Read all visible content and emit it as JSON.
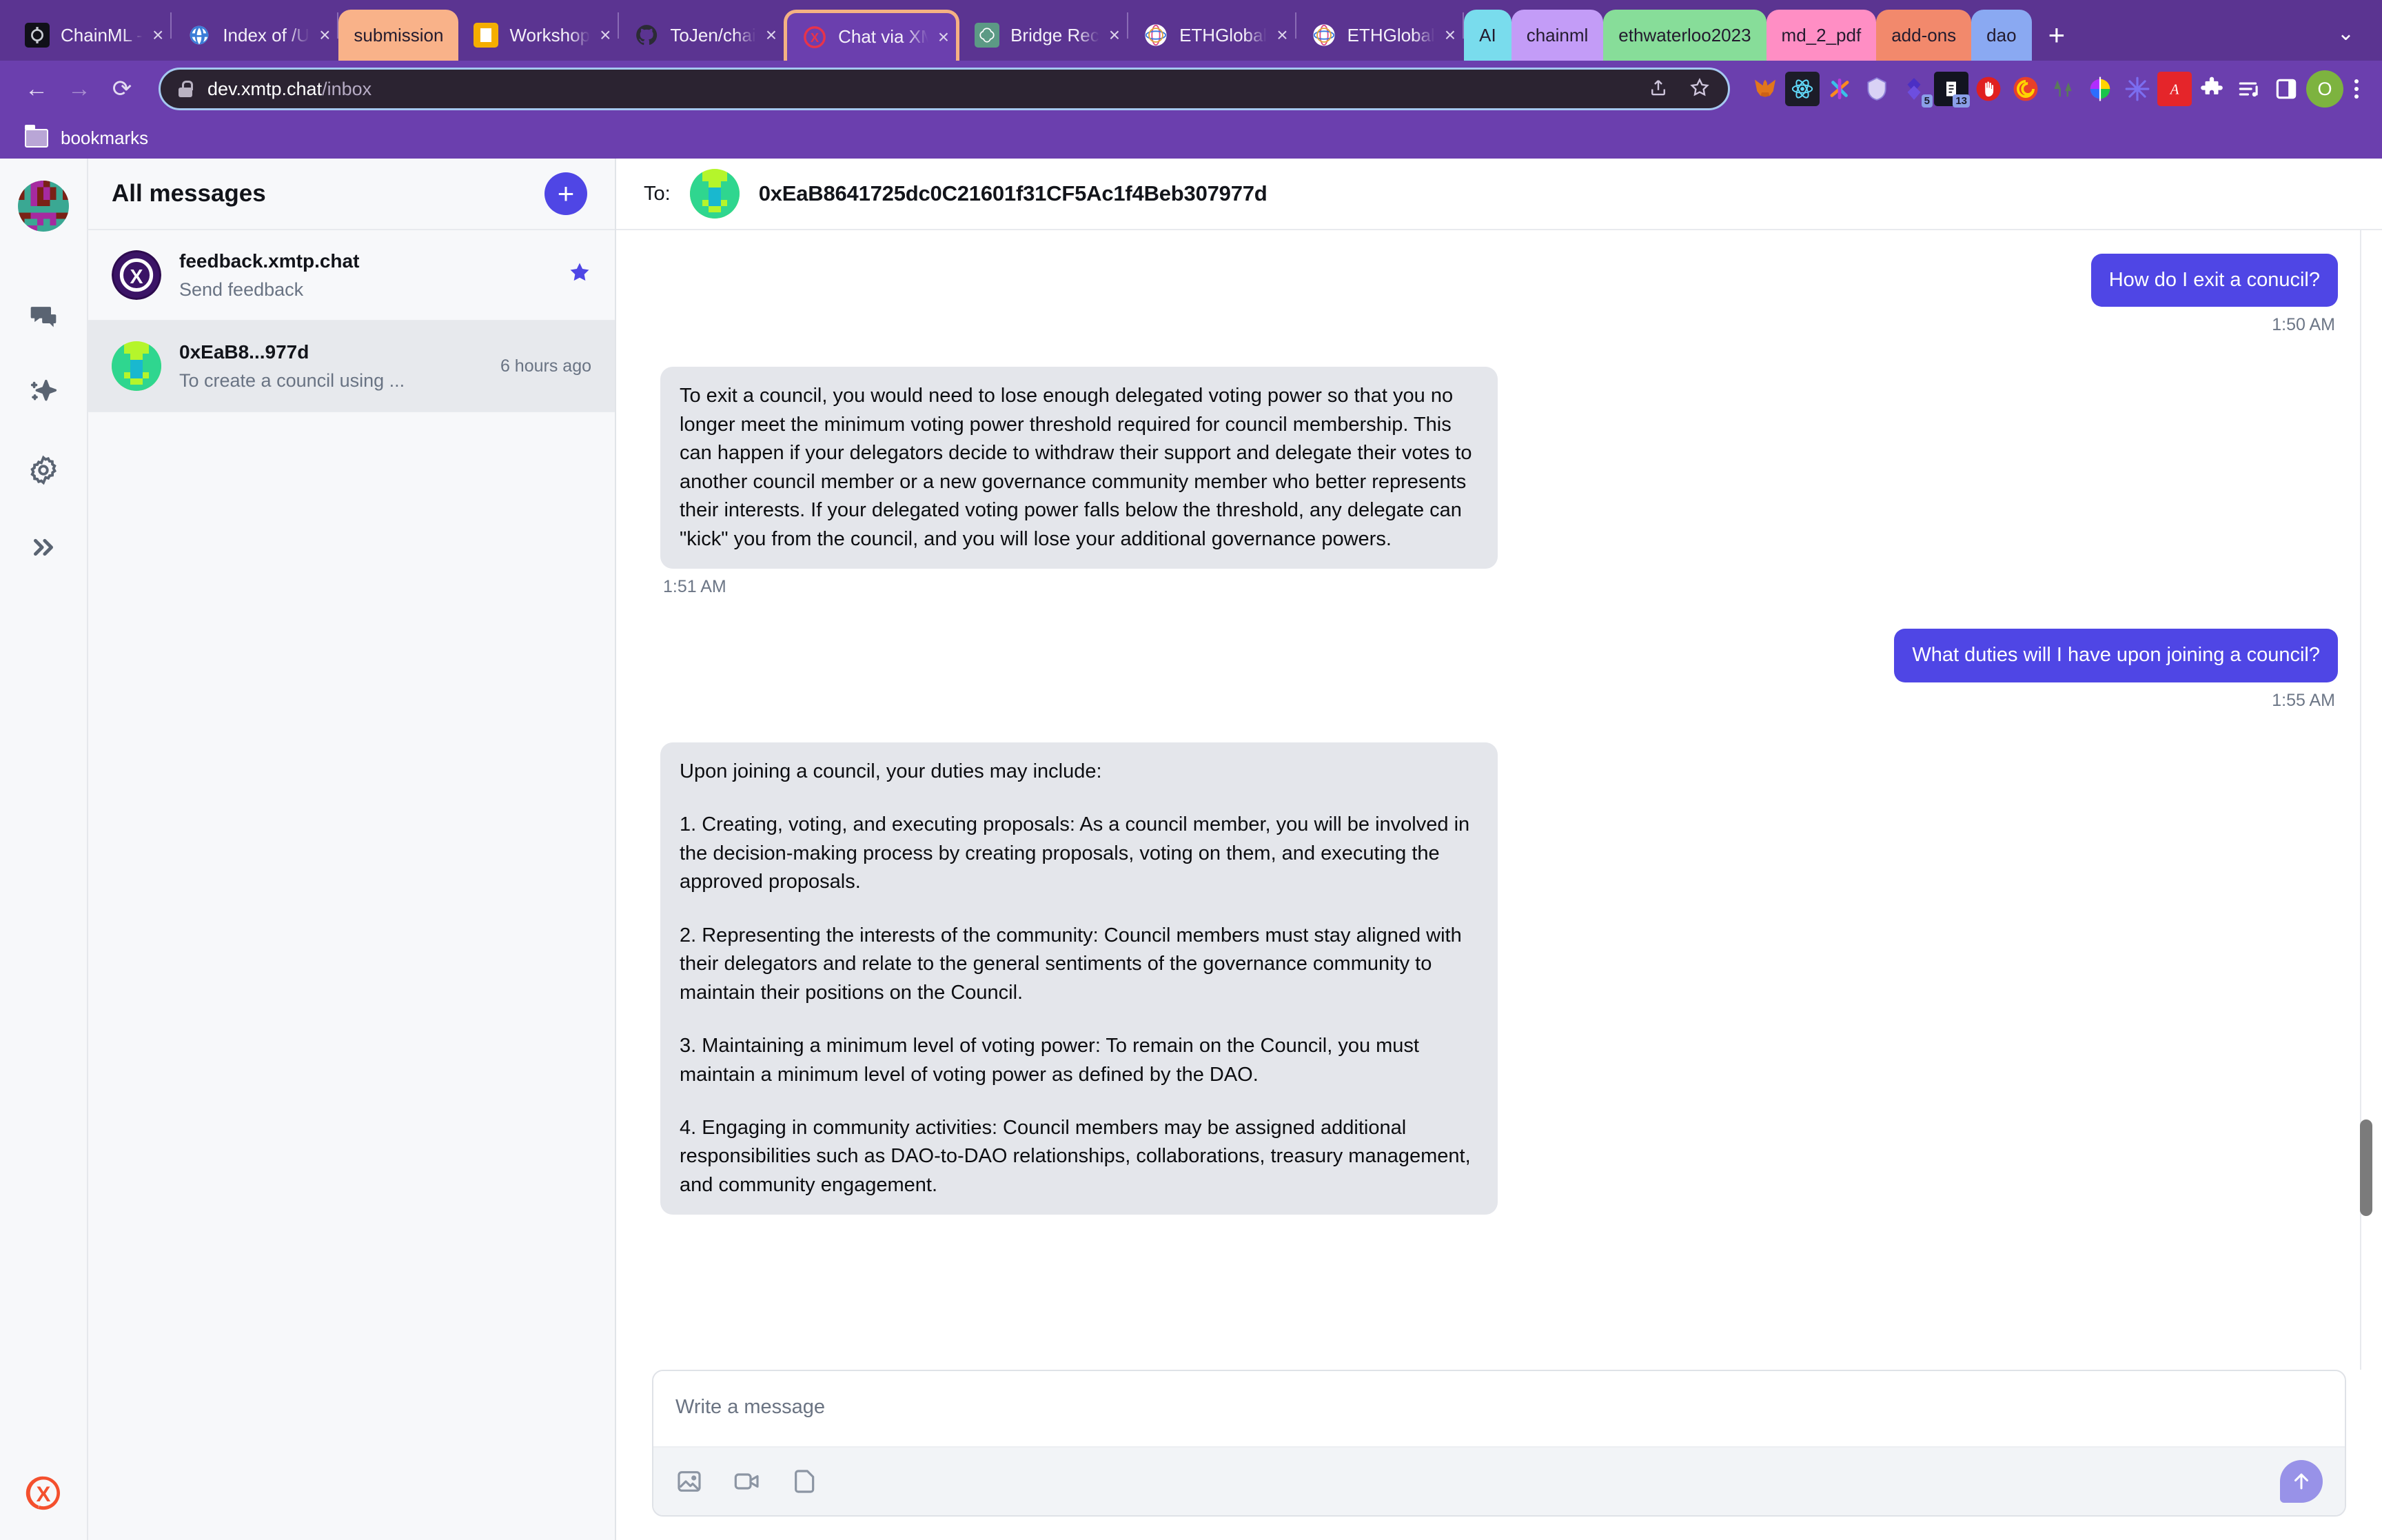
{
  "browser": {
    "tabs": [
      {
        "title": "ChainML -",
        "favicon": "chainml-icon",
        "close": "×",
        "active": false
      },
      {
        "title": "Index of /U",
        "favicon": "globe-icon",
        "close": "×",
        "active": false
      },
      {
        "title": "Workshop",
        "favicon": "workshop-icon",
        "close": "×",
        "active": false
      },
      {
        "title": "ToJen/chai",
        "favicon": "github-icon",
        "close": "×",
        "active": false
      },
      {
        "title": "Chat via XM",
        "favicon": "xmtp-icon",
        "close": "×",
        "active": true
      },
      {
        "title": "Bridge Rec",
        "favicon": "openai-icon",
        "close": "×",
        "active": false
      },
      {
        "title": "ETHGlobal",
        "favicon": "ethglobal-icon",
        "close": "×",
        "active": false
      },
      {
        "title": "ETHGlobal",
        "favicon": "ethglobal-icon",
        "close": "×",
        "active": false
      }
    ],
    "pinned_tab": {
      "label": "submission",
      "color": "#f9b289"
    },
    "tab_groups": [
      {
        "label": "AI",
        "color": "#79dced"
      },
      {
        "label": "chainml",
        "color": "#c39cf7"
      },
      {
        "label": "ethwaterloo2023",
        "color": "#87dd99"
      },
      {
        "label": "md_2_pdf",
        "color": "#ff8ec4"
      },
      {
        "label": "add-ons",
        "color": "#f2896c"
      },
      {
        "label": "dao",
        "color": "#8aa9f2"
      }
    ],
    "new_tab_label": "+",
    "tab_search_label": "⌄",
    "nav": {
      "back": "←",
      "forward": "→",
      "reload": "⟳"
    },
    "omnibox": {
      "host": "dev.xmtp.chat",
      "path": "/inbox",
      "share_icon": "share-icon",
      "bookmark_icon": "star-icon"
    },
    "profile_initial": "O",
    "bookmarks": [
      {
        "label": "bookmarks",
        "icon": "folder-icon"
      }
    ],
    "theme": {
      "chrome_bg": "#5b3491",
      "toolbar_bg": "#6b3fae",
      "active_tab_bg": "#6b3fae",
      "active_tab_outline": "#f5b183"
    }
  },
  "app": {
    "rail": {
      "avatar": "user-avatar",
      "items": [
        {
          "name": "messages",
          "icon": "chat-bubbles-icon"
        },
        {
          "name": "ai",
          "icon": "sparkle-icon"
        },
        {
          "name": "settings",
          "icon": "gear-icon"
        },
        {
          "name": "expand",
          "icon": "double-chevron-right-icon"
        }
      ],
      "logo": "xmtp-logo"
    },
    "conversations": {
      "title": "All messages",
      "new_button_label": "+",
      "items": [
        {
          "name": "feedback.xmtp.chat",
          "preview": "Send feedback",
          "time": "",
          "starred": true,
          "selected": false,
          "avatar": "xmtp-avatar"
        },
        {
          "name": "0xEaB8...977d",
          "preview": "To create a council using ...",
          "time": "6 hours ago",
          "starred": false,
          "selected": true,
          "avatar": "green-pixel-avatar"
        }
      ]
    },
    "chat_header": {
      "to_label": "To:",
      "address": "0xEaB8641725dc0C21601f31CF5Ac1f4Beb307977d",
      "avatar": "green-pixel-avatar"
    },
    "messages": [
      {
        "direction": "out",
        "time": "1:50 AM",
        "paragraphs": [
          "How do I exit a conucil?"
        ]
      },
      {
        "direction": "in",
        "time": "1:51 AM",
        "paragraphs": [
          "To exit a council, you would need to lose enough delegated voting power so that you no longer meet the minimum voting power threshold required for council membership. This can happen if your delegators decide to withdraw their support and delegate their votes to another council member or a new governance community member who better represents their interests. If your delegated voting power falls below the threshold, any delegate can \"kick\" you from the council, and you will lose your additional governance powers."
        ]
      },
      {
        "direction": "out",
        "time": "1:55 AM",
        "paragraphs": [
          "What duties will I have upon joining a council?"
        ]
      },
      {
        "direction": "in",
        "time": "",
        "paragraphs": [
          "Upon joining a council, your duties may include:",
          "1. Creating, voting, and executing proposals: As a council member, you will be involved in the decision-making process by creating proposals, voting on them, and executing the approved proposals.",
          "2. Representing the interests of the community: Council members must stay aligned with their delegators and relate to the general sentiments of the governance community to maintain their positions on the Council.",
          "3. Maintaining a minimum level of voting power: To remain on the Council, you must maintain a minimum level of voting power as defined by the DAO.",
          "4. Engaging in community activities: Council members may be assigned additional responsibilities such as DAO-to-DAO relationships, collaborations, treasury management, and community engagement."
        ]
      }
    ],
    "composer": {
      "placeholder": "Write a message",
      "tools": [
        {
          "name": "attach-image",
          "icon": "image-icon"
        },
        {
          "name": "attach-video",
          "icon": "video-camera-icon"
        },
        {
          "name": "attach-file",
          "icon": "document-icon"
        }
      ],
      "send_icon": "arrow-up-icon"
    },
    "colors": {
      "outgoing_bubble": "#4f46e5",
      "incoming_bubble": "#e4e6eb",
      "accent": "#4f46e5",
      "sidebar_bg": "#f7f8fa"
    }
  }
}
